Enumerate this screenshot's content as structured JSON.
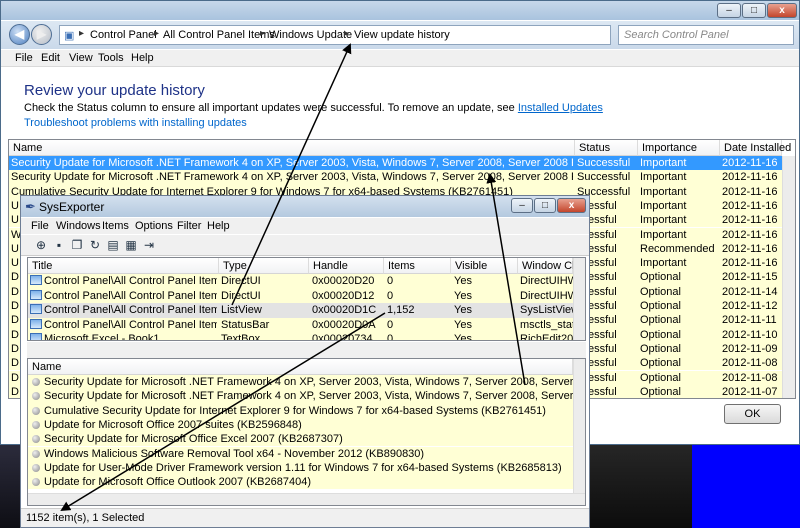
{
  "control_panel": {
    "breadcrumbs": [
      "Control Panel",
      "All Control Panel Items",
      "Windows Update",
      "View update history"
    ],
    "search_placeholder": "Search Control Panel",
    "menu": [
      "File",
      "Edit",
      "View",
      "Tools",
      "Help"
    ],
    "heading": "Review your update history",
    "description": "Check the Status column to ensure all important updates were successful. To remove an update, see",
    "installed_link": "Installed Updates",
    "troubleshoot_link": "Troubleshoot problems with installing updates",
    "columns": [
      "Name",
      "Status",
      "Importance",
      "Date Installed"
    ],
    "rows": [
      [
        "Security Update for Microsoft .NET Framework 4 on XP, Server 2003, Vista, Windows 7, Server 2008, Server 2008 R2 for x64 (KB2737019)",
        "Successful",
        "Important",
        "2012-11-16"
      ],
      [
        "Security Update for Microsoft .NET Framework 4 on XP, Server 2003, Vista, Windows 7, Server 2008, Server 2008 R2 for x64 (KB2729449)",
        "Successful",
        "Important",
        "2012-11-16"
      ],
      [
        "Cumulative Security Update for Internet Explorer 9 for Windows 7 for x64-based Systems (KB2761451)",
        "Successful",
        "Important",
        "2012-11-16"
      ],
      [
        "U",
        "ccessful",
        "Important",
        "2012-11-16"
      ],
      [
        "U",
        "ccessful",
        "Important",
        "2012-11-16"
      ],
      [
        "W",
        "ccessful",
        "Important",
        "2012-11-16"
      ],
      [
        "U",
        "ccessful",
        "Recommended",
        "2012-11-16"
      ],
      [
        "U",
        "ccessful",
        "Important",
        "2012-11-16"
      ],
      [
        "D",
        "ccessful",
        "Optional",
        "2012-11-15"
      ],
      [
        "D",
        "ccessful",
        "Optional",
        "2012-11-14"
      ],
      [
        "D",
        "ccessful",
        "Optional",
        "2012-11-12"
      ],
      [
        "D",
        "ccessful",
        "Optional",
        "2012-11-11"
      ],
      [
        "D",
        "ccessful",
        "Optional",
        "2012-11-10"
      ],
      [
        "D",
        "ccessful",
        "Optional",
        "2012-11-09"
      ],
      [
        "D",
        "ccessful",
        "Optional",
        "2012-11-08"
      ],
      [
        "D",
        "ccessful",
        "Optional",
        "2012-11-08"
      ],
      [
        "D",
        "ccessful",
        "Optional",
        "2012-11-07"
      ]
    ],
    "ok_label": "OK",
    "min_label": "–",
    "max_label": "□",
    "close_label": "x"
  },
  "sysexporter": {
    "title": "SysExporter",
    "menu": [
      "File",
      "Windows",
      "Items",
      "Options",
      "Filter",
      "Help"
    ],
    "top_columns": [
      "Title",
      "Type",
      "Handle",
      "Items",
      "Visible",
      "Window Clas"
    ],
    "top_rows": [
      [
        "Control Panel\\All Control Panel Items\\Wi...",
        "DirectUI",
        "0x00020D20",
        "0",
        "Yes",
        "DirectUIHWN"
      ],
      [
        "Control Panel\\All Control Panel Items\\Wi...",
        "DirectUI",
        "0x00020D12",
        "0",
        "Yes",
        "DirectUIHWN"
      ],
      [
        "Control Panel\\All Control Panel Items\\Wi...",
        "ListView",
        "0x00020D1C",
        "1,152",
        "Yes",
        "SysListView3"
      ],
      [
        "Control Panel\\All Control Panel Items\\Wi...",
        "StatusBar",
        "0x00020D0A",
        "0",
        "Yes",
        "msctls_status"
      ],
      [
        "Microsoft Excel - Book1",
        "TextBox",
        "0x00020734",
        "0",
        "Yes",
        "RichEdit20W"
      ]
    ],
    "bottom_column": "Name",
    "bottom_rows": [
      "Security Update for Microsoft .NET Framework 4 on XP, Server 2003, Vista, Windows 7, Server 2008, Server 2008 R2 for x64 (KB2737019)",
      "Security Update for Microsoft .NET Framework 4 on XP, Server 2003, Vista, Windows 7, Server 2008, Server 2008 R2 for x64 (KB2729449)",
      "Cumulative Security Update for Internet Explorer 9 for Windows 7 for x64-based Systems (KB2761451)",
      "Update for Microsoft Office 2007 suites (KB2596848)",
      "Security Update for Microsoft Office Excel 2007 (KB2687307)",
      "Windows Malicious Software Removal Tool x64 - November 2012 (KB890830)",
      "Update for User-Mode Driver Framework version 1.11 for Windows 7 for x64-based Systems (KB2685813)",
      "Update for Microsoft Office Outlook 2007 (KB2687404)"
    ],
    "status": "1152 item(s), 1 Selected",
    "min_label": "–",
    "max_label": "□",
    "close_label": "x"
  },
  "colors": {
    "row_bg": "#ffffd5",
    "selection": "#3399ff",
    "heading": "#1e3287",
    "link": "#0066cc",
    "arrow": "#000000"
  }
}
